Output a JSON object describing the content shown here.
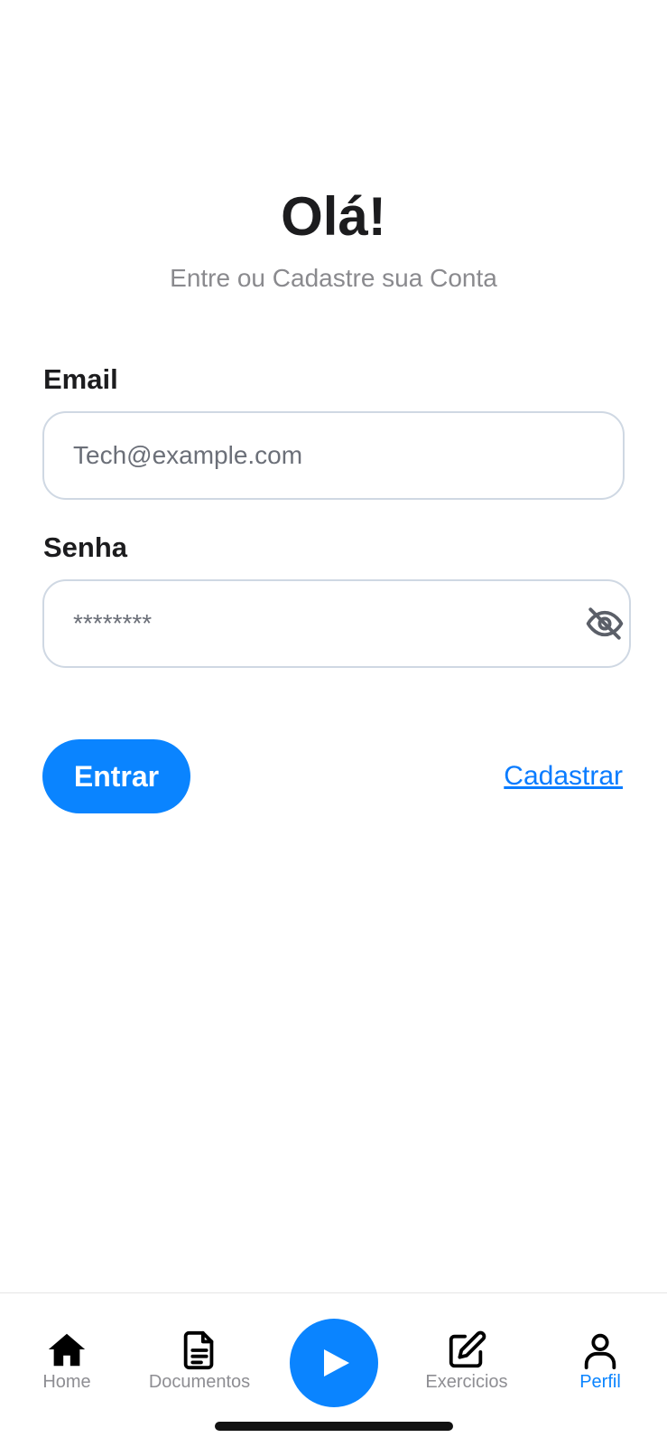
{
  "header": {
    "title": "Olá!",
    "subtitle": "Entre ou Cadastre sua Conta"
  },
  "form": {
    "email": {
      "label": "Email",
      "placeholder": "Tech@example.com",
      "value": ""
    },
    "password": {
      "label": "Senha",
      "placeholder": "********",
      "value": "",
      "toggle_icon": "eye-off-icon"
    },
    "login_label": "Entrar",
    "signup_label": "Cadastrar"
  },
  "tabbar": {
    "items": [
      {
        "label": "Home",
        "icon": "home-icon",
        "active": false
      },
      {
        "label": "Documentos",
        "icon": "document-icon",
        "active": false
      },
      {
        "label": "",
        "icon": "play-icon",
        "active": false
      },
      {
        "label": "Exercicios",
        "icon": "edit-icon",
        "active": false
      },
      {
        "label": "Perfil",
        "icon": "user-icon",
        "active": true
      }
    ]
  },
  "colors": {
    "accent": "#0a84ff",
    "text_primary": "#1c1c1e",
    "text_secondary": "#8a8a8e",
    "input_border": "#cfd8e3",
    "tab_inactive": "#8e8e93"
  }
}
